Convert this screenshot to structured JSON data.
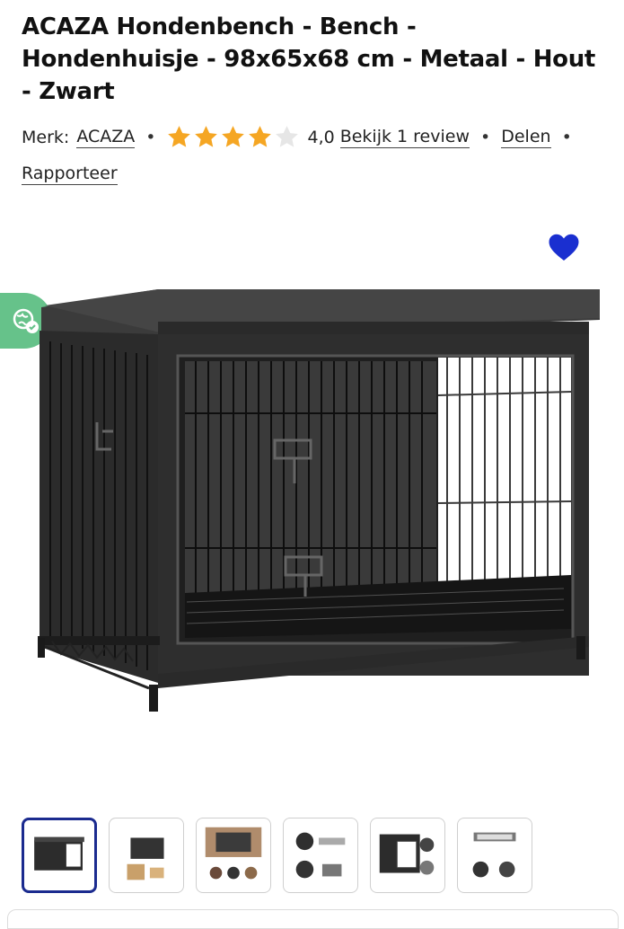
{
  "product": {
    "title": "ACAZA Hondenbench - Bench - Hondenhuisje - 98x65x68 cm - Metaal - Hout - Zwart",
    "brand_label": "Merk:",
    "brand": "ACAZA",
    "rating_value": "4,0",
    "rating_stars_filled": 4,
    "rating_stars_total": 5,
    "review_link": "Bekijk 1 review",
    "share_link": "Delen",
    "report_link": "Rapporteer",
    "separator": "•"
  },
  "icons": {
    "wishlist": "heart-icon",
    "translate": "translate-icon",
    "star": "star-icon"
  },
  "colors": {
    "heart": "#1a2fd0",
    "star_filled": "#f5a623",
    "star_empty": "#e6e6e6",
    "active_thumb_border": "#1b2b8f",
    "translate_tab": "#66c28a"
  },
  "gallery": {
    "thumbnail_count": 6,
    "active_index": 0
  }
}
